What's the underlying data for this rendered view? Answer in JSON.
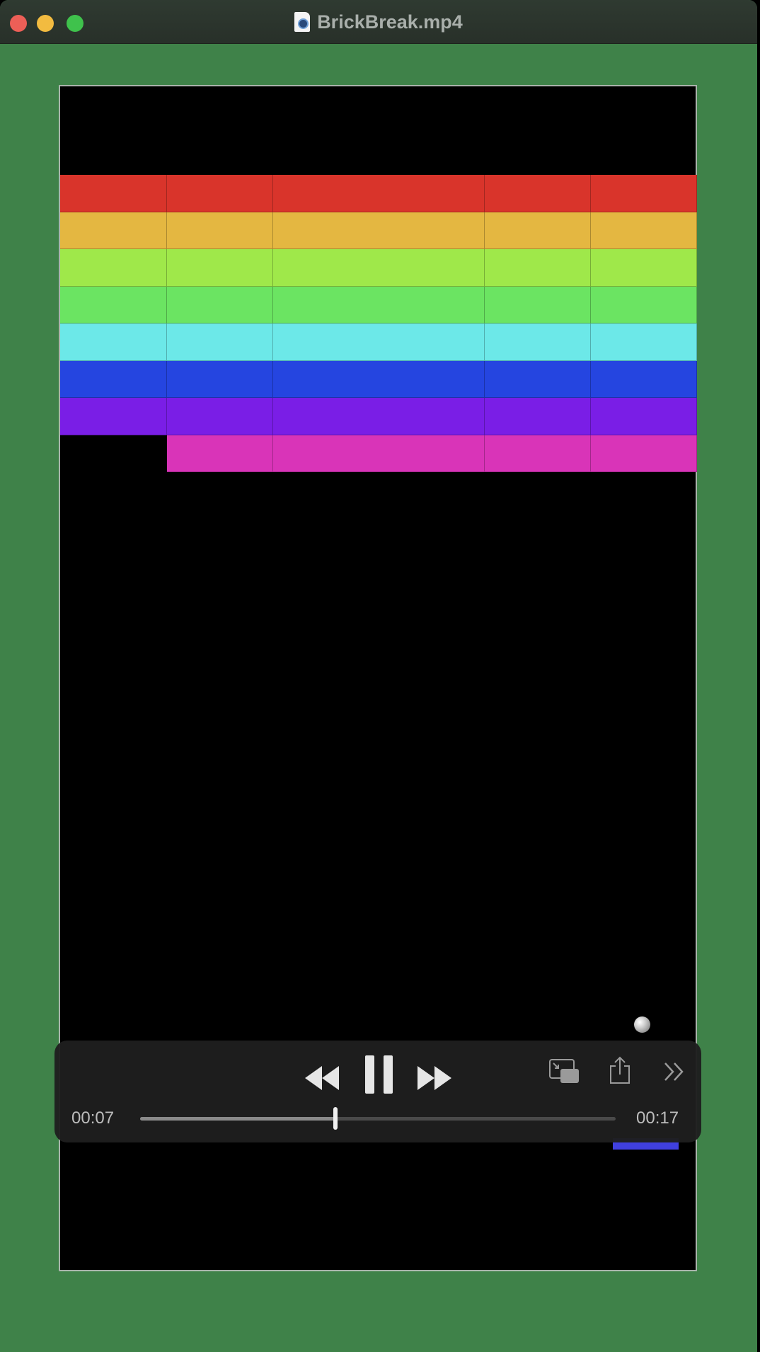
{
  "window": {
    "title": "BrickBreak.mp4",
    "background_color": "#3f8249"
  },
  "game": {
    "brick_colors": [
      "#d9342b",
      "#e4b741",
      "#9fe84a",
      "#6be462",
      "#6ce8e8",
      "#2545e0",
      "#7a1ee6",
      "#d934b8"
    ],
    "brick_layout": [
      [
        1,
        1,
        1,
        1,
        1
      ],
      [
        1,
        1,
        1,
        1,
        1
      ],
      [
        1,
        1,
        1,
        1,
        1
      ],
      [
        1,
        1,
        1,
        1,
        1
      ],
      [
        1,
        1,
        1,
        1,
        1
      ],
      [
        1,
        1,
        1,
        1,
        1
      ],
      [
        1,
        1,
        1,
        1,
        1
      ],
      [
        0,
        1,
        1,
        1,
        1
      ]
    ],
    "paddle_color": "#4040e0"
  },
  "player": {
    "current_time": "00:07",
    "total_time": "00:17",
    "progress": 0.41,
    "icons": {
      "rewind": "rewind-icon",
      "pause": "pause-icon",
      "forward": "fast-forward-icon",
      "pip": "picture-in-picture-icon",
      "share": "share-icon",
      "more": "more-chevron-icon"
    }
  }
}
